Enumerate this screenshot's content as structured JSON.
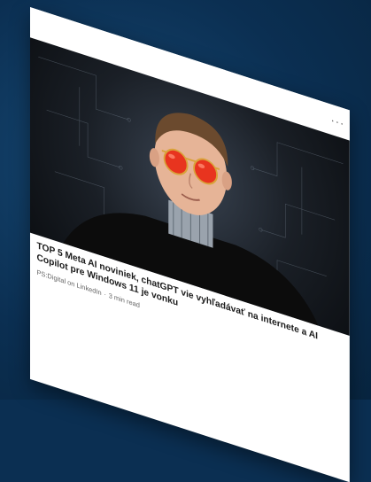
{
  "post": {
    "menu_icon": "more-icon",
    "menu_glyph": "···",
    "headline": "TOP 5 Meta AI noviniek, chatGPT vie vyhľadávať na internete a AI Copilot pre Windows 11 je vonku",
    "source": "PS:Digital on LinkedIn",
    "separator": "·",
    "read_time": "3 min read"
  },
  "colors": {
    "background": "#0b2f52",
    "card": "#ffffff",
    "sunglasses": "#e8341f",
    "frame": "#d9a33a"
  }
}
